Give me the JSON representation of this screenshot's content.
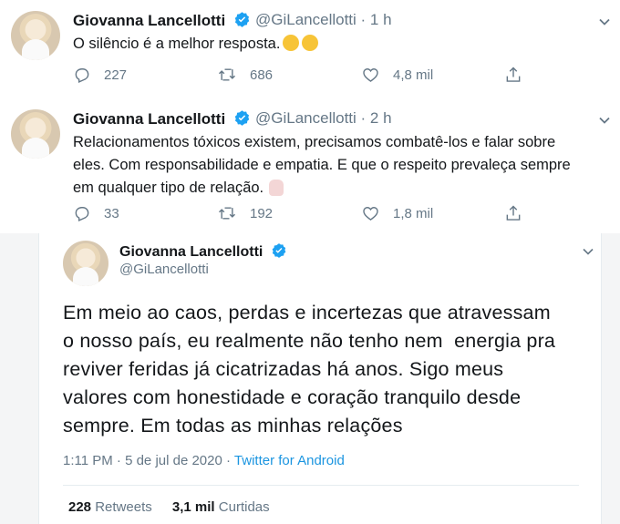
{
  "tweets": [
    {
      "name": "Giovanna Lancellotti",
      "handle": "@GiLancellotti · 1 h",
      "text": "O silêncio é a melhor resposta.",
      "replies": "227",
      "retweets": "686",
      "likes": "4,8 mil"
    },
    {
      "name": "Giovanna Lancellotti",
      "handle": "@GiLancellotti · 2 h",
      "text_lines": [
        "Relacionamentos tóxicos existem, precisamos combatê-los e falar sobre",
        "eles. Com responsabilidade e empatia. E que o respeito prevaleça sempre",
        "em qualquer tipo de relação."
      ],
      "replies": "33",
      "retweets": "192",
      "likes": "1,8 mil"
    }
  ],
  "expanded": {
    "name": "Giovanna Lancellotti",
    "handle": "@GiLancellotti",
    "text_lines": [
      "Em meio ao caos, perdas e incertezas que atravessam",
      "o nosso país, eu realmente não tenho nem  energia pra",
      "reviver feridas já cicatrizadas há anos. Sigo meus",
      "valores com honestidade e coração tranquilo desde",
      "sempre. Em todas as minhas relações"
    ],
    "time": "1:11 PM · 5 de jul de 2020 · ",
    "source": "Twitter for Android",
    "retweets_count": "228",
    "retweets_label": "Retweets",
    "likes_count": "3,1 mil",
    "likes_label": "Curtidas"
  },
  "colors": {
    "text": "#14171a",
    "secondary": "#657786",
    "link": "#1b95e0",
    "verified": "#1da1f2"
  },
  "icons": [
    "reply-icon",
    "retweet-icon",
    "like-icon",
    "share-icon",
    "verified-badge-icon",
    "chevron-down-icon"
  ]
}
